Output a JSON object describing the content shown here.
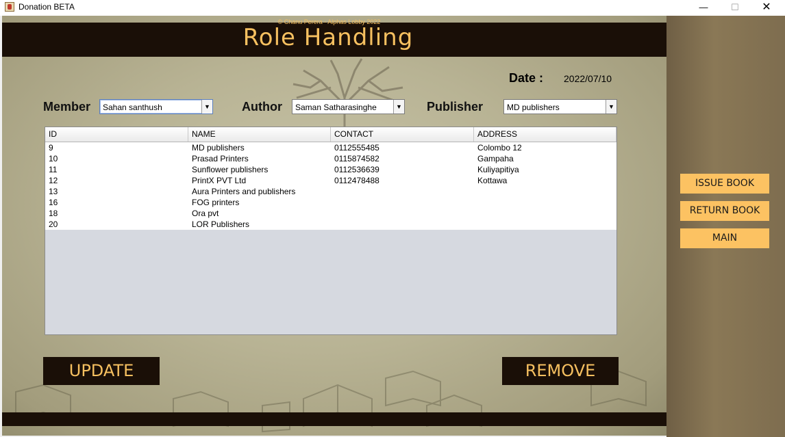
{
  "window": {
    "title": "Donation BETA",
    "minimize": "—",
    "maximize": "☐",
    "close": "✕"
  },
  "header": {
    "title": "Role Handling"
  },
  "date": {
    "label": "Date :",
    "value": "2022/07/10"
  },
  "filters": {
    "member": {
      "label": "Member",
      "value": "Sahan santhush"
    },
    "author": {
      "label": "Author",
      "value": "Saman Satharasinghe"
    },
    "publisher": {
      "label": "Publisher",
      "value": "MD publishers"
    }
  },
  "table": {
    "columns": [
      "ID",
      "NAME",
      "CONTACT",
      "ADDRESS"
    ],
    "rows": [
      [
        "9",
        "MD publishers",
        "0112555485",
        "Colombo 12"
      ],
      [
        "10",
        "Prasad Printers",
        "0115874582",
        "Gampaha"
      ],
      [
        "11",
        "Sunflower publishers",
        "0112536639",
        "Kuliyapitiya"
      ],
      [
        "12",
        "PrintX PVT Ltd",
        "0112478488",
        "Kottawa"
      ],
      [
        "13",
        "Aura Printers and publishers",
        "",
        ""
      ],
      [
        "16",
        "FOG printers",
        "",
        ""
      ],
      [
        "18",
        "Ora pvt",
        "",
        ""
      ],
      [
        "20",
        "LOR Publishers",
        "",
        ""
      ]
    ]
  },
  "actions": {
    "update": "UPDATE",
    "remove": "REMOVE"
  },
  "footer": {
    "text": "© Chanu Perera - Alphas Lobby 2022"
  },
  "sidebar": {
    "issue_book": "ISSUE BOOK",
    "return_book": "RETURN BOOK",
    "main": "MAIN"
  },
  "colors": {
    "accent": "#f6c060",
    "dark": "#1a0f07",
    "side_button": "#fcc262"
  }
}
